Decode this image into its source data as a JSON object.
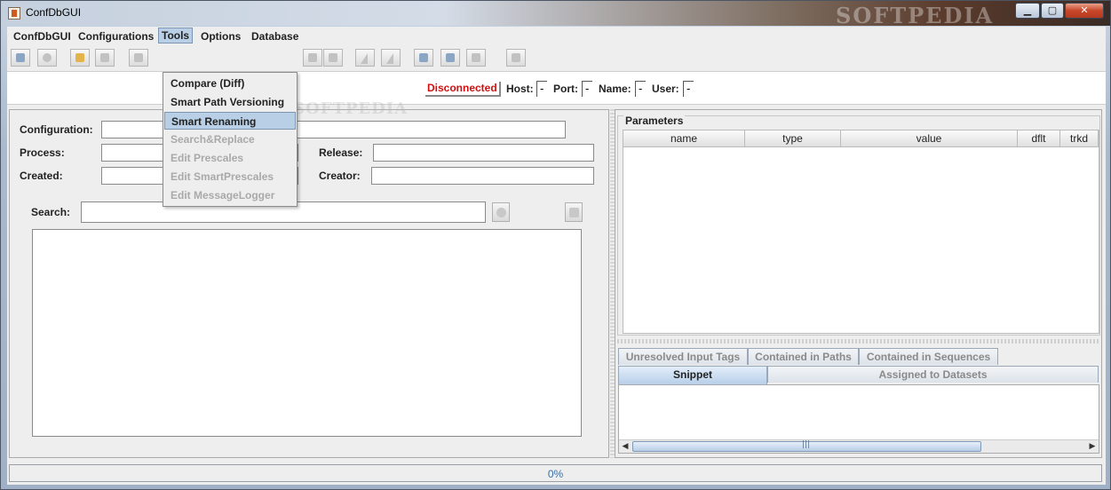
{
  "window": {
    "title": "ConfDbGUI",
    "watermark": "SOFTPEDIA",
    "buttons": {
      "minimize": "▁",
      "maximize": "▢",
      "close": "✕"
    }
  },
  "menubar": {
    "items": [
      "ConfDbGUI",
      "Configurations",
      "Tools",
      "Options",
      "Database"
    ]
  },
  "tools_menu": {
    "items": [
      {
        "label": "Compare (Diff)",
        "enabled": true
      },
      {
        "label": "Smart Path Versioning",
        "enabled": true
      },
      {
        "label": "Smart Renaming",
        "enabled": true,
        "highlighted": true
      },
      {
        "label": "Search&Replace",
        "enabled": false
      },
      {
        "label": "Edit Prescales",
        "enabled": false
      },
      {
        "label": "Edit SmartPrescales",
        "enabled": false
      },
      {
        "label": "Edit MessageLogger",
        "enabled": false
      }
    ]
  },
  "connection": {
    "status": "Disconnected",
    "host_label": "Host:",
    "host_value": "-",
    "port_label": "Port:",
    "port_value": "-",
    "name_label": "Name:",
    "name_value": "-",
    "user_label": "User:",
    "user_value": "-"
  },
  "form": {
    "configuration_label": "Configuration:",
    "process_label": "Process:",
    "release_label": "Release:",
    "created_label": "Created:",
    "creator_label": "Creator:",
    "search_label": "Search:"
  },
  "parameters": {
    "title": "Parameters",
    "columns": [
      "name",
      "type",
      "value",
      "dflt",
      "trkd"
    ]
  },
  "tabs": {
    "row1": [
      "Unresolved Input Tags",
      "Contained in Paths",
      "Contained in Sequences"
    ],
    "row2": [
      "Snippet",
      "Assigned to Datasets"
    ],
    "selected": "Snippet"
  },
  "scrollbar": {
    "left": "◀",
    "right": "▶",
    "grip": "|||"
  },
  "progress": {
    "text": "0%",
    "value": 0
  },
  "colors": {
    "disconnected": "#d01010",
    "progress_text": "#3a6ea8",
    "highlight": "#b8cfe5"
  }
}
